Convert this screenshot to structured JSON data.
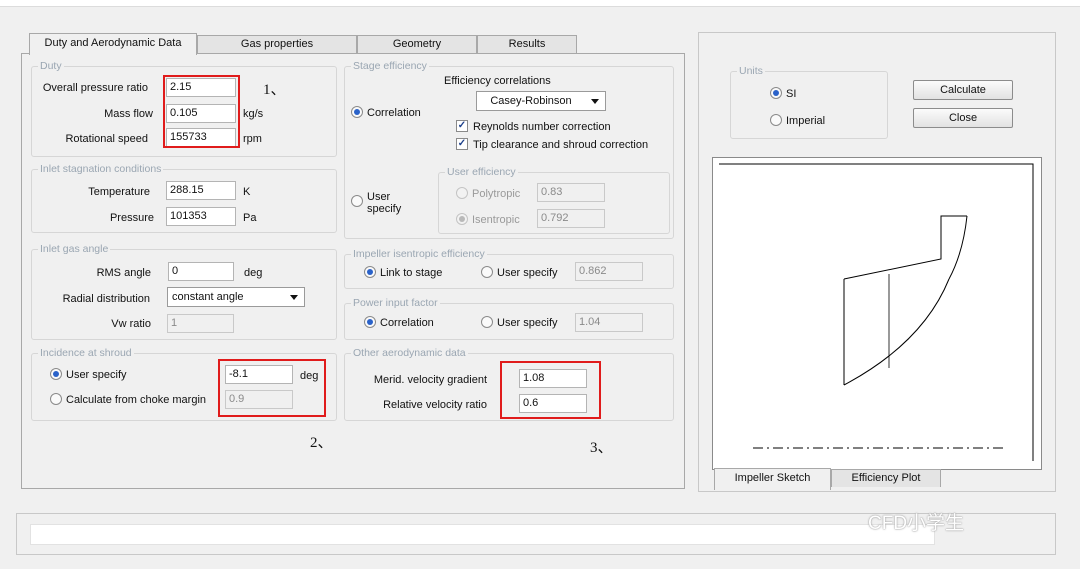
{
  "tabs": [
    {
      "label": "Duty and Aerodynamic Data",
      "active": true
    },
    {
      "label": "Gas properties",
      "active": false
    },
    {
      "label": "Geometry",
      "active": false
    },
    {
      "label": "Results",
      "active": false
    }
  ],
  "duty": {
    "title": "Duty",
    "pressure_ratio_label": "Overall pressure ratio",
    "pressure_ratio_value": "2.15",
    "mass_flow_label": "Mass flow",
    "mass_flow_value": "0.105",
    "mass_flow_unit": "kg/s",
    "speed_label": "Rotational speed",
    "speed_value": "155733",
    "speed_unit": "rpm"
  },
  "inlet_stagnation": {
    "title": "Inlet stagnation conditions",
    "temperature_label": "Temperature",
    "temperature_value": "288.15",
    "temperature_unit": "K",
    "pressure_label": "Pressure",
    "pressure_value": "101353",
    "pressure_unit": "Pa"
  },
  "inlet_gas_angle": {
    "title": "Inlet gas angle",
    "rms_label": "RMS angle",
    "rms_value": "0",
    "rms_unit": "deg",
    "radial_label": "Radial distribution",
    "radial_value": "constant angle",
    "vw_label": "Vw ratio",
    "vw_value": "1"
  },
  "incidence": {
    "title": "Incidence at shroud",
    "user_label": "User specify",
    "user_value": "-8.1",
    "user_unit": "deg",
    "choke_label": "Calculate from choke margin",
    "choke_value": "0.9"
  },
  "stage_efficiency": {
    "title": "Stage efficiency",
    "correlation_label": "Correlation",
    "correlations_title": "Efficiency correlations",
    "correlation_value": "Casey-Robinson",
    "reynolds_label": "Reynolds number correction",
    "tip_label": "Tip clearance and shroud correction",
    "user_label_1": "User",
    "user_label_2": "specify",
    "user_eff_title": "User efficiency",
    "polytropic_label": "Polytropic",
    "polytropic_value": "0.83",
    "isentropic_label": "Isentropic",
    "isentropic_value": "0.792"
  },
  "impeller_eff": {
    "title": "Impeller isentropic efficiency",
    "link_label": "Link to stage",
    "user_label": "User specify",
    "value": "0.862"
  },
  "power_input": {
    "title": "Power input factor",
    "correlation_label": "Correlation",
    "user_label": "User specify",
    "value": "1.04"
  },
  "other_aero": {
    "title": "Other aerodynamic data",
    "merid_label": "Merid. velocity gradient",
    "merid_value": "1.08",
    "rel_label": "Relative velocity ratio",
    "rel_value": "0.6"
  },
  "units": {
    "title": "Units",
    "si_label": "SI",
    "imperial_label": "Imperial"
  },
  "buttons": {
    "calculate": "Calculate",
    "close": "Close"
  },
  "sketch_tabs": [
    {
      "label": "Impeller Sketch",
      "active": true
    },
    {
      "label": "Efficiency Plot",
      "active": false
    }
  ],
  "annotations": [
    "1、",
    "2、",
    "3、"
  ],
  "watermark": "CFD小学生",
  "colors": {
    "highlight": "#e01b1b",
    "radio_selected": "#2a62c9"
  }
}
